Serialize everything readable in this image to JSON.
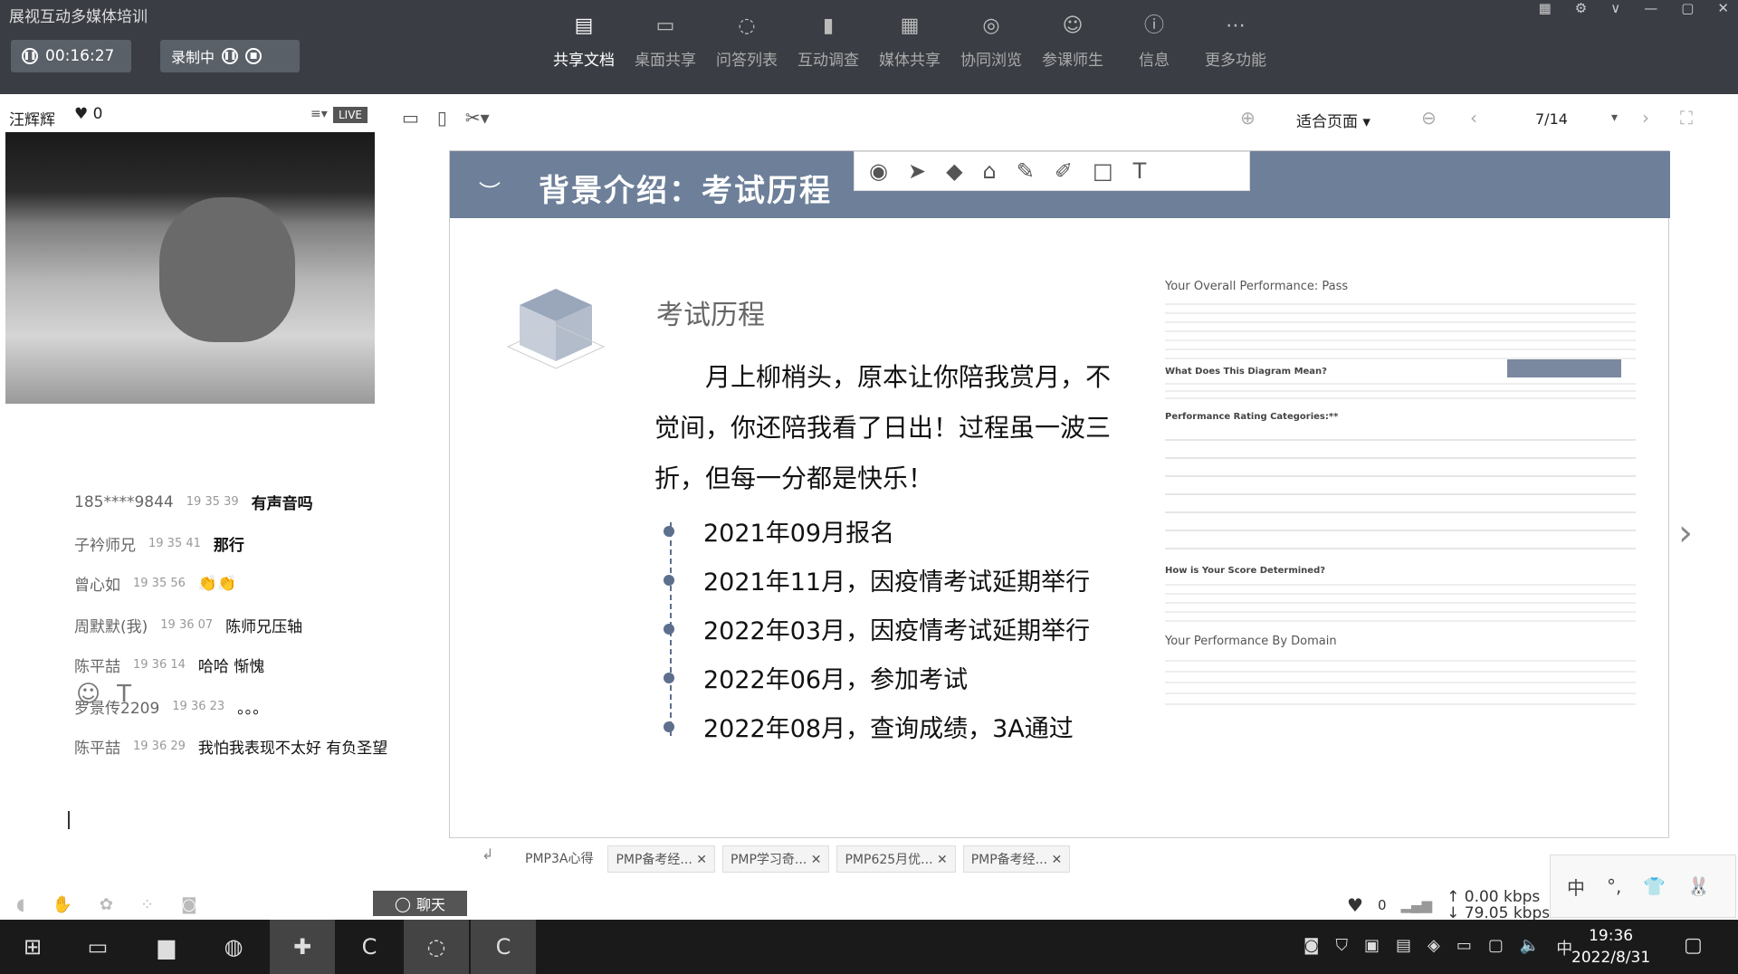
{
  "app": {
    "title": "展视互动多媒体培训"
  },
  "recording": {
    "timer": "00:16:27",
    "status": "录制中"
  },
  "toolbar": {
    "items": [
      {
        "label": "共享文档",
        "icon": "document-icon"
      },
      {
        "label": "桌面共享",
        "icon": "desktop-share-icon"
      },
      {
        "label": "问答列表",
        "icon": "qa-icon"
      },
      {
        "label": "互动调查",
        "icon": "survey-icon"
      },
      {
        "label": "媒体共享",
        "icon": "media-icon"
      },
      {
        "label": "协同浏览",
        "icon": "browse-icon"
      },
      {
        "label": "参课师生",
        "icon": "participants-icon"
      },
      {
        "label": "信息",
        "icon": "info-icon"
      },
      {
        "label": "更多功能",
        "icon": "more-icon"
      }
    ]
  },
  "presenter": {
    "name": "汪辉辉",
    "likes": "0",
    "live_badge": "LIVE"
  },
  "chat": {
    "messages": [
      {
        "user": "185****9844",
        "time": "19 35 39",
        "text": "有声音吗"
      },
      {
        "user": "子衿师兄",
        "time": "19 35 41",
        "text": "那行"
      },
      {
        "user": "曾心如",
        "time": "19 35 56",
        "text": "👏👏"
      },
      {
        "user": "周默默(我)",
        "time": "19 36 07",
        "text": "陈师兄压轴"
      },
      {
        "user": "陈平喆",
        "time": "19 36 14",
        "text": "哈哈  惭愧"
      },
      {
        "user": "罗景传2209",
        "time": "19 36 23",
        "text": "。。。"
      },
      {
        "user": "陈平喆",
        "time": "19 36 29",
        "text": "我怕我表现不太好  有负圣望"
      }
    ],
    "chat_button": "聊天"
  },
  "viewer": {
    "zoom": "适合页面",
    "page": "7/14"
  },
  "slide": {
    "header_title": "背景介绍：考试历程",
    "section_title": "考试历程",
    "poem": "月上柳梢头，原本让你陪我赏月，不觉间，你还陪我看了日出！过程虽一波三折，但每一分都是快乐！",
    "timeline": [
      "2021年09月报名",
      "2021年11月，因疫情考试延期举行",
      "2022年03月，因疫情考试延期举行",
      "2022年06月，参加考试",
      "2022年08月，查询成绩，3A通过"
    ],
    "report": {
      "title": "Your Overall Performance: Pass",
      "q1": "What Does This Diagram Mean?",
      "q2": "Performance Rating Categories:**",
      "q3": "How is Your Score Determined?",
      "q4": "Your Performance By Domain"
    }
  },
  "tabs": [
    "PMP3A心得",
    "PMP备考经...",
    "PMP学习奇...",
    "PMP625月优...",
    "PMP备考经..."
  ],
  "status": {
    "likes": "0",
    "up": "0.00 kbps",
    "down": "79.05 kbps"
  },
  "ime": {
    "lang": "中"
  },
  "clock": {
    "time": "19:36",
    "date": "2022/8/31"
  }
}
